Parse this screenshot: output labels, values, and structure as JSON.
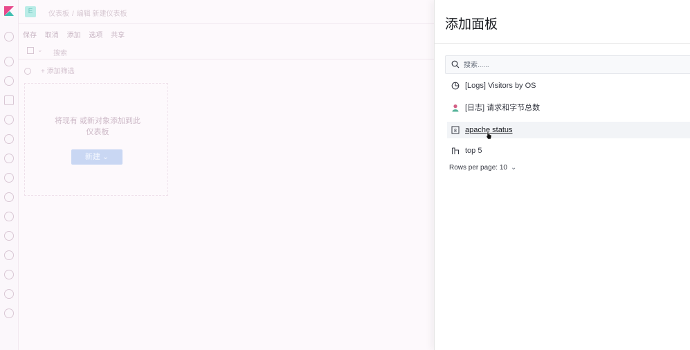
{
  "background": {
    "breadcrumbs": [
      "仪表板",
      "编辑 新建仪表板"
    ],
    "menu": [
      "保存",
      "取消",
      "添加",
      "选项",
      "共享"
    ],
    "query_placeholder": "搜索",
    "add_filter": "+ 添加筛选",
    "empty_text": "将现有 或新对象添加到此 仪表板",
    "new_button": "新建 ⌄",
    "app_badge": "E"
  },
  "flyout": {
    "title": "添加面板",
    "search_placeholder": "搜索......",
    "items": [
      {
        "label": "[Logs] Visitors by OS",
        "icon": "pie-chart-icon"
      },
      {
        "label": "[日志] 请求和字节总数",
        "icon": "user-icon"
      },
      {
        "label": "apache status",
        "icon": "metric-icon"
      },
      {
        "label": "top 5",
        "icon": "table-icon"
      }
    ],
    "rows_per_page": "Rows per page: 10"
  },
  "colors": {
    "accent": "#0077cc",
    "badge": "#b9ece7",
    "logo_pink": "#e8488b",
    "logo_teal": "#3ebeb0"
  }
}
